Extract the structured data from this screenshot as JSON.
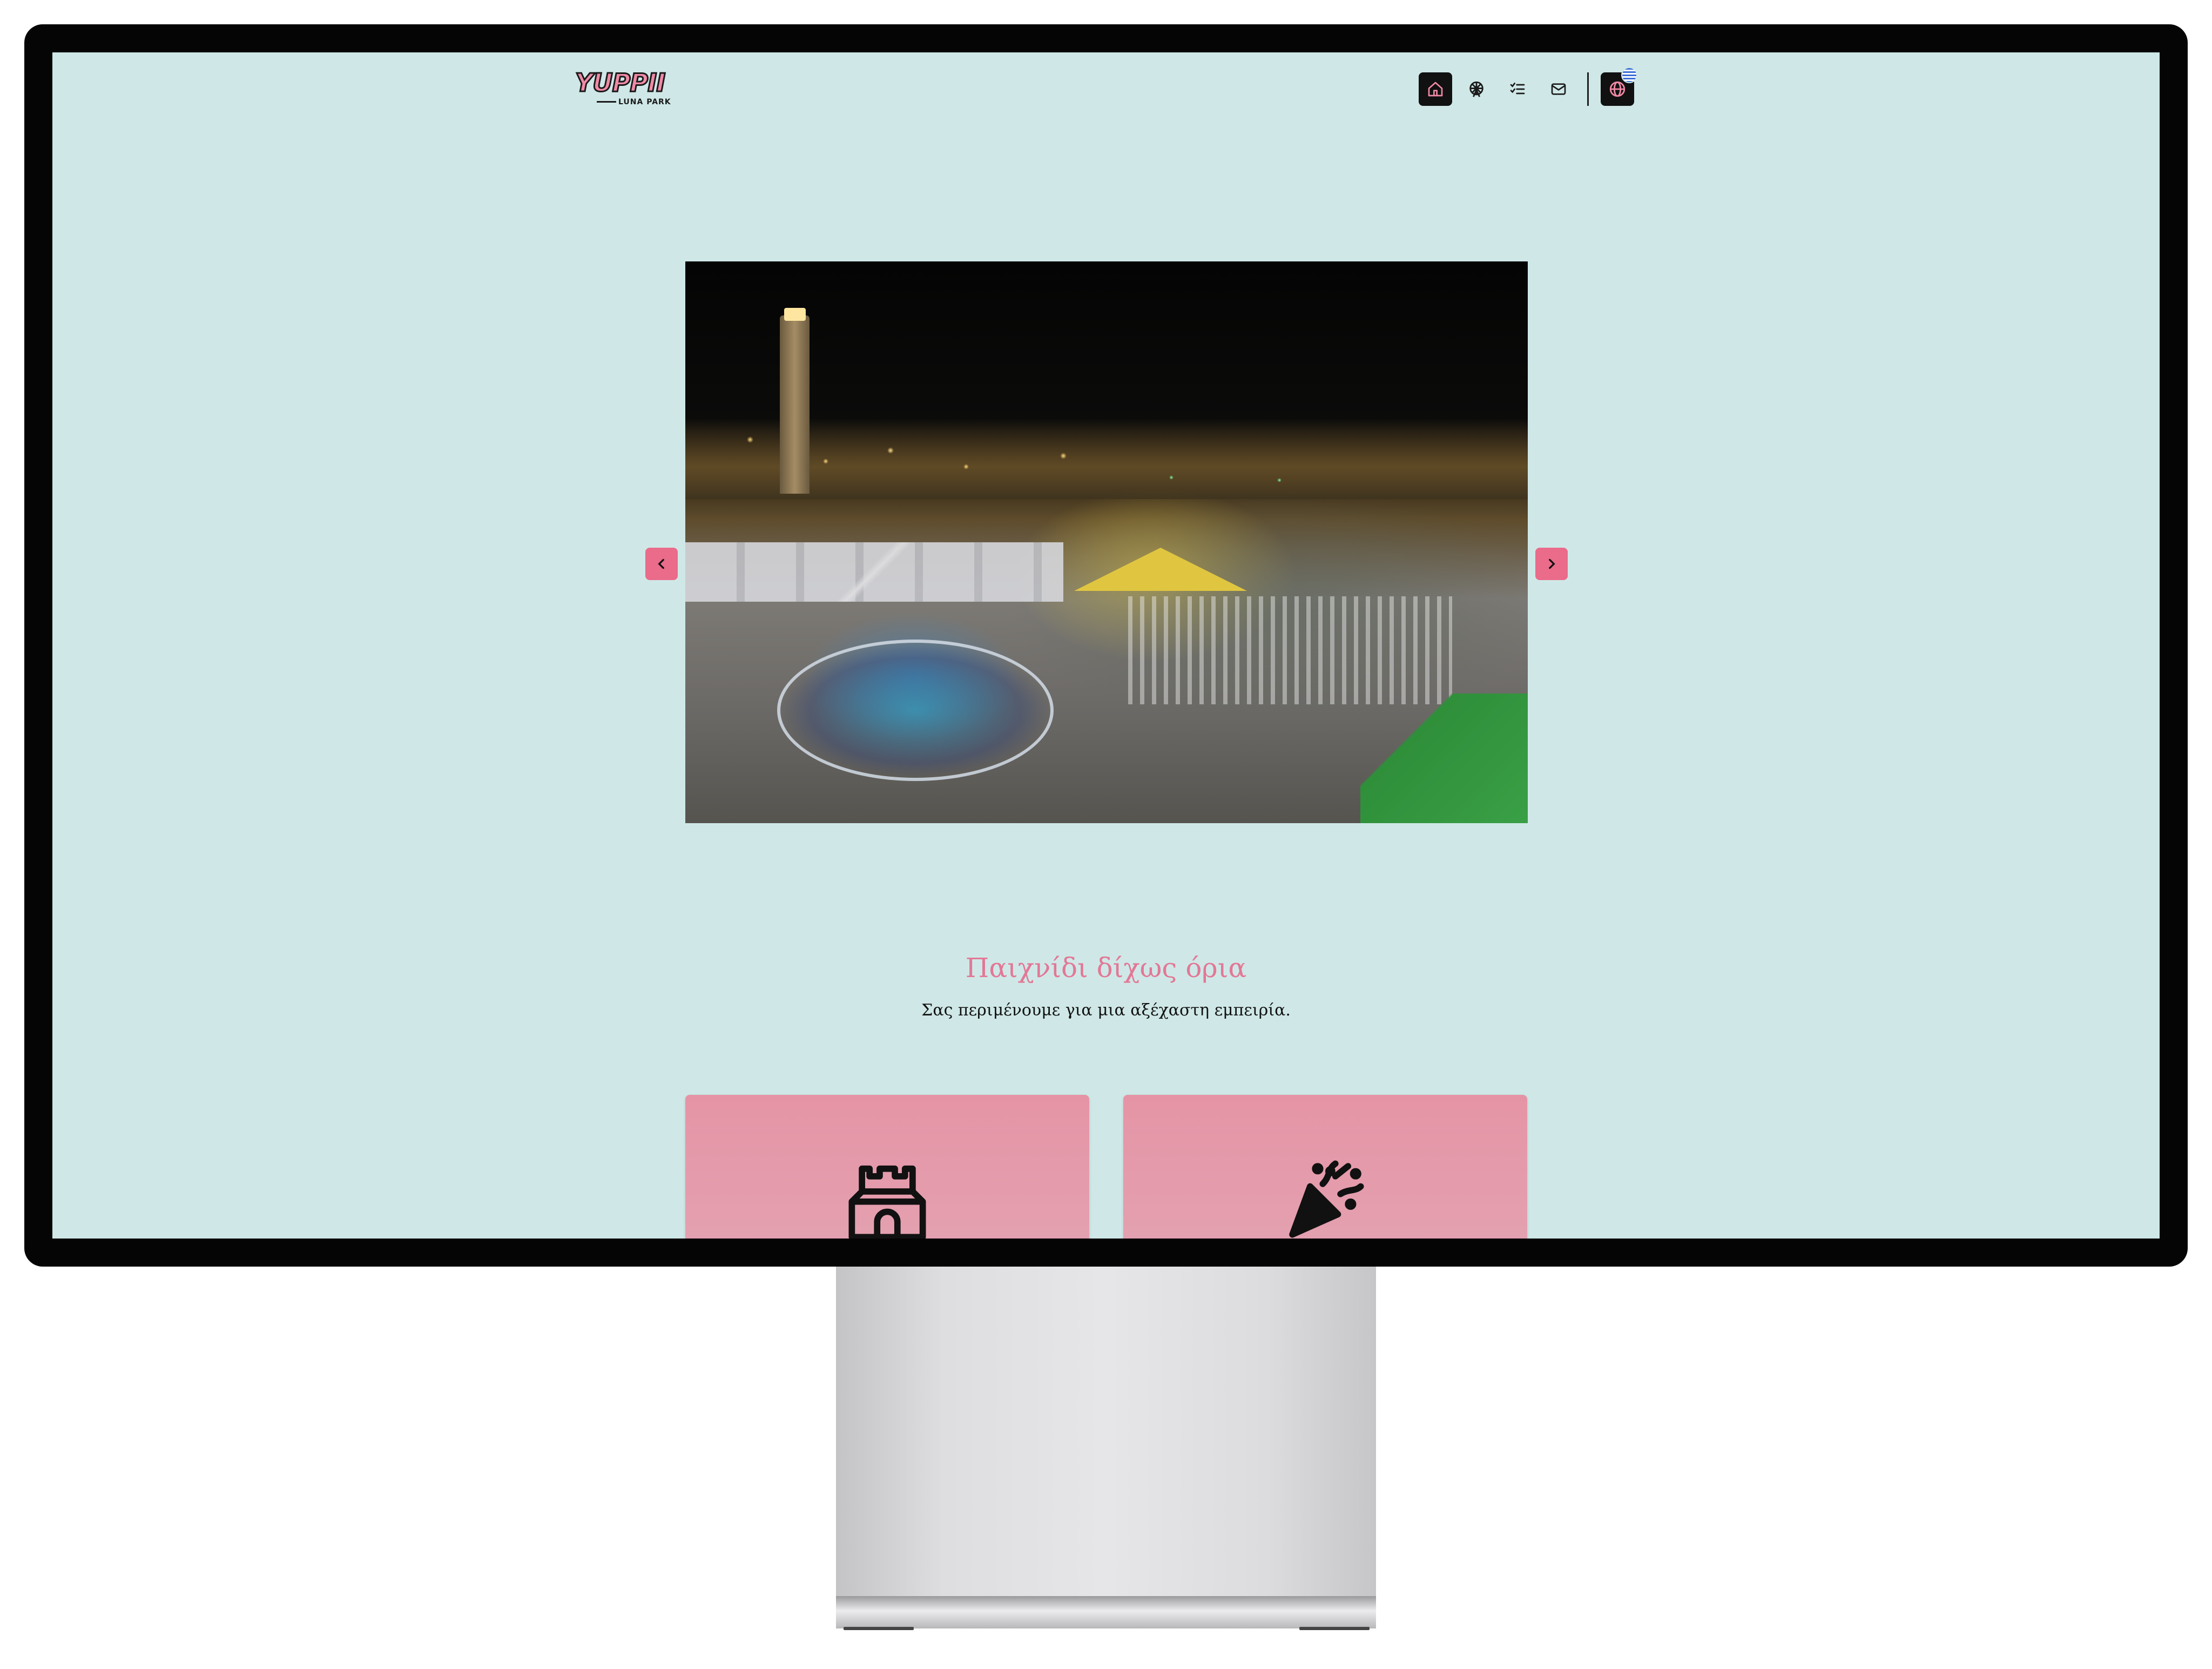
{
  "site": {
    "logo": {
      "title": "YUPPII",
      "subtitle": "LUNA PARK"
    }
  },
  "nav": {
    "items": [
      {
        "icon": "home-icon",
        "active": true
      },
      {
        "icon": "ferris-wheel-icon",
        "active": false
      },
      {
        "icon": "checklist-icon",
        "active": false
      },
      {
        "icon": "mail-icon",
        "active": false
      }
    ],
    "language": {
      "icon": "globe-icon",
      "flag": "greek-flag"
    }
  },
  "carousel": {
    "image_alt": "",
    "prev_icon": "chevron-left-icon",
    "next_icon": "chevron-right-icon"
  },
  "intro": {
    "headline": "Παιχνίδι δίχως όρια",
    "subtext": "Σας περιμένουμε για μια αξέχαστη εμπειρία."
  },
  "cards": [
    {
      "icon": "castle-icon"
    },
    {
      "icon": "party-popper-icon"
    }
  ],
  "colors": {
    "background": "#cfe8e7",
    "accent_pink": "#e27896",
    "card_pink": "#e594a5",
    "nav_active": "#111111"
  }
}
